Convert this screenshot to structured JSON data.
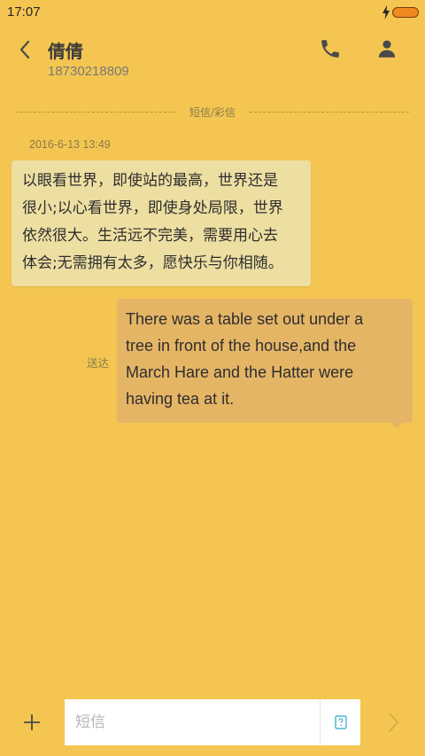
{
  "status_bar": {
    "time": "17:07",
    "icons": [
      "charging-bolt-icon",
      "battery-icon"
    ]
  },
  "header": {
    "contact_name": "倩倩",
    "contact_number": "18730218809",
    "icons": {
      "back": "back-arrow-icon",
      "call": "phone-icon",
      "contact": "person-icon"
    }
  },
  "conversation": {
    "divider_label": "短信/彩信",
    "messages": [
      {
        "direction": "incoming",
        "timestamp": "2016-6-13 13:49",
        "lines": [
          "以眼看世界，即使站的最高，世界还是",
          "很小;以心看世界，即使身处局限，世界",
          "依然很大。生活远不完美，需要用心去",
          "体会;无需拥有太多，愿快乐与你相随。"
        ]
      },
      {
        "direction": "outgoing",
        "status": "送达",
        "lines": [
          "There was a table set out under a",
          "tree in front of the house,and the",
          "March Hare and the Hatter were",
          "having tea at it."
        ]
      }
    ]
  },
  "composer": {
    "placeholder": "短信",
    "value": "",
    "icons": {
      "add": "plus-icon",
      "template": "sms-template-icon",
      "send": "send-chevron-icon"
    }
  },
  "colors": {
    "background": "#f4c651",
    "incoming_bubble": "#eddfa2",
    "outgoing_bubble": "#e5b566",
    "battery": "#ef8a1e"
  }
}
